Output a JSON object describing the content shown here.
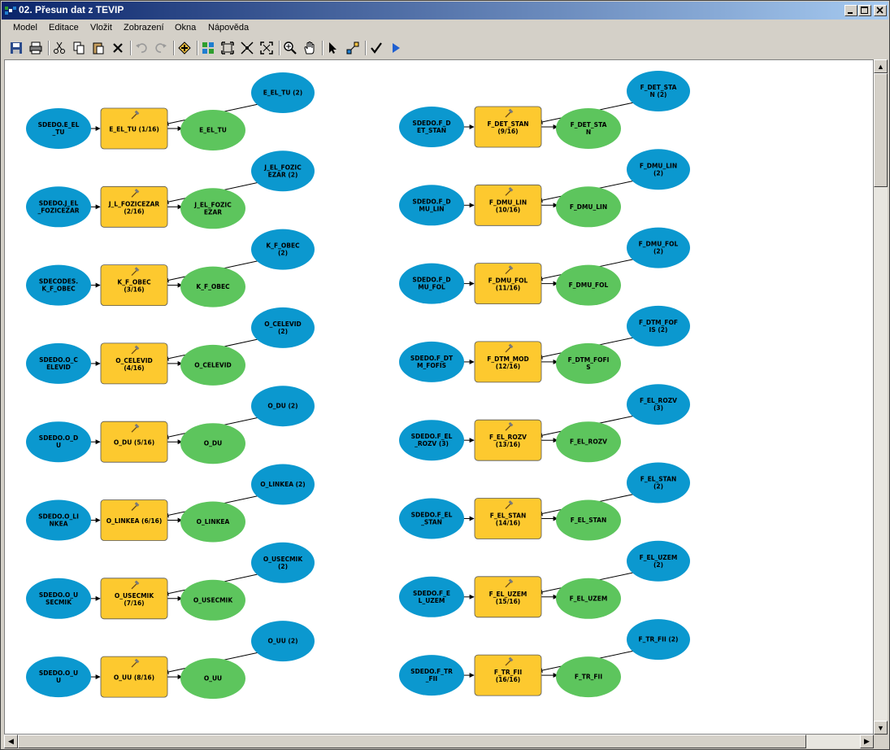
{
  "window": {
    "title": "02. Přesun dat z TEVIP"
  },
  "menu": [
    "Model",
    "Editace",
    "Vložit",
    "Zobrazení",
    "Okna",
    "Nápověda"
  ],
  "toolbar": [
    "save-icon",
    "print-icon",
    "sep",
    "cut-icon",
    "copy-icon",
    "paste-icon",
    "delete-icon",
    "sep",
    "undo-icon",
    "redo-icon",
    "sep",
    "add-data-icon",
    "sep",
    "auto-layout-icon",
    "full-extent-icon",
    "fit-icon",
    "zoom-extent-icon",
    "sep",
    "zoom-in-icon",
    "pan-icon",
    "sep",
    "select-icon",
    "connect-icon",
    "sep",
    "validate-icon",
    "run-icon"
  ],
  "colors": {
    "input": "#0b98cf",
    "tool": "#fdc92f",
    "output": "#5dc55d",
    "title_start": "#0a246a"
  },
  "model": {
    "left": [
      {
        "input": [
          "SDEDO.E_EL",
          "_TU"
        ],
        "tool": [
          "E_EL_TU (1/16)"
        ],
        "output": [
          "E_EL_TU"
        ],
        "param": [
          "E_EL_TU (2)"
        ]
      },
      {
        "input": [
          "SDEDO.J_EL",
          "_FOZICEZAR"
        ],
        "tool": [
          "J_L_FOZICEZAR",
          "(2/16)"
        ],
        "output": [
          "J_EL_FOZIC",
          "EZAR"
        ],
        "param": [
          "J_EL_FOZIC",
          "EZAR (2)"
        ]
      },
      {
        "input": [
          "SDECODES.",
          "K_F_OBEC"
        ],
        "tool": [
          "K_F_OBEC",
          "(3/16)"
        ],
        "output": [
          "K_F_OBEC"
        ],
        "param": [
          "K_F_OBEC",
          "(2)"
        ]
      },
      {
        "input": [
          "SDEDO.O_C",
          "ELEVID"
        ],
        "tool": [
          "O_CELEVID",
          "(4/16)"
        ],
        "output": [
          "O_CELEVID"
        ],
        "param": [
          "O_CELEVID",
          "(2)"
        ]
      },
      {
        "input": [
          "SDEDO.O_D",
          "U"
        ],
        "tool": [
          "O_DU (5/16)"
        ],
        "output": [
          "O_DU"
        ],
        "param": [
          "O_DU (2)"
        ]
      },
      {
        "input": [
          "SDEDO.O_LI",
          "NKEA"
        ],
        "tool": [
          "O_LINKEA (6/16)"
        ],
        "output": [
          "O_LINKEA"
        ],
        "param": [
          "O_LINKEA (2)"
        ]
      },
      {
        "input": [
          "SDEDO.O_U",
          "SECMIK"
        ],
        "tool": [
          "O_USECMIK",
          "(7/16)"
        ],
        "output": [
          "O_USECMIK"
        ],
        "param": [
          "O_USECMIK",
          "(2)"
        ]
      },
      {
        "input": [
          "SDEDO.O_U",
          "U"
        ],
        "tool": [
          "O_UU (8/16)"
        ],
        "output": [
          "O_UU"
        ],
        "param": [
          "O_UU (2)"
        ]
      }
    ],
    "right": [
      {
        "input": [
          "SDEDO.F_D",
          "ET_STAN"
        ],
        "tool": [
          "F_DET_STAN",
          "(9/16)"
        ],
        "output": [
          "F_DET_STA",
          "N"
        ],
        "param": [
          "F_DET_STA",
          "N (2)"
        ]
      },
      {
        "input": [
          "SDEDO.F_D",
          "MU_LIN"
        ],
        "tool": [
          "F_DMU_LIN",
          "(10/16)"
        ],
        "output": [
          "F_DMU_LIN"
        ],
        "param": [
          "F_DMU_LIN",
          "(2)"
        ]
      },
      {
        "input": [
          "SDEDO.F_D",
          "MU_FOL"
        ],
        "tool": [
          "F_DMU_FOL",
          "(11/16)"
        ],
        "output": [
          "F_DMU_FOL"
        ],
        "param": [
          "F_DMU_FOL",
          "(2)"
        ]
      },
      {
        "input": [
          "SDEDO.F_DT",
          "M_FOFIS"
        ],
        "tool": [
          "F_DTM_MOD",
          "(12/16)"
        ],
        "output": [
          "F_DTM_FOFI",
          "S"
        ],
        "param": [
          "F_DTM_FOF",
          "IS (2)"
        ]
      },
      {
        "input": [
          "SDEDO.F_EL",
          "_ROZV (3)"
        ],
        "tool": [
          "F_EL_ROZV",
          "(13/16)"
        ],
        "output": [
          "F_EL_ROZV"
        ],
        "param": [
          "F_EL_ROZV",
          "(3)"
        ]
      },
      {
        "input": [
          "SDEDO.F_EL",
          "_STAN"
        ],
        "tool": [
          "F_EL_STAN",
          "(14/16)"
        ],
        "output": [
          "F_EL_STAN"
        ],
        "param": [
          "F_EL_STAN",
          "(2)"
        ]
      },
      {
        "input": [
          "SDEDO.F_E",
          "L_UZEM"
        ],
        "tool": [
          "F_EL_UZEM",
          "(15/16)"
        ],
        "output": [
          "F_EL_UZEM"
        ],
        "param": [
          "F_EL_UZEM",
          "(2)"
        ]
      },
      {
        "input": [
          "SDEDO.F_TR",
          "_FII"
        ],
        "tool": [
          "F_TR_FII",
          "(16/16)"
        ],
        "output": [
          "F_TR_FII"
        ],
        "param": [
          "F_TR_FII (2)"
        ]
      }
    ]
  }
}
